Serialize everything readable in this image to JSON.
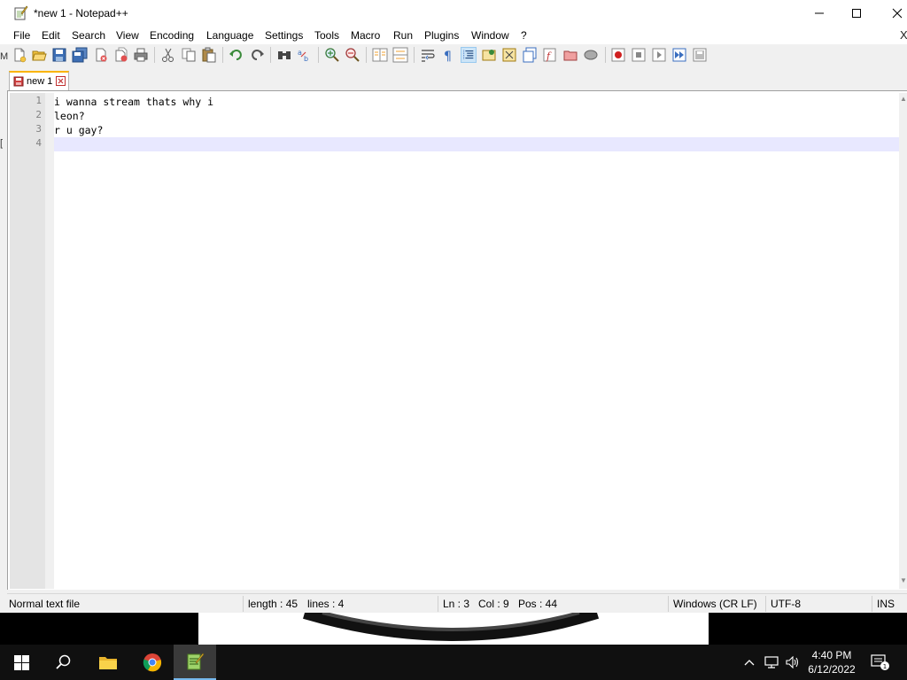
{
  "window": {
    "title": "*new 1 - Notepad++"
  },
  "menu": {
    "items": [
      "File",
      "Edit",
      "Search",
      "View",
      "Encoding",
      "Language",
      "Settings",
      "Tools",
      "Macro",
      "Run",
      "Plugins",
      "Window",
      "?"
    ],
    "close_glyph": "X"
  },
  "toolbar": {
    "icons": [
      "new-file-icon",
      "open-file-icon",
      "save-icon",
      "save-all-icon",
      "close-icon",
      "close-all-icon",
      "print-icon",
      "cut-icon",
      "copy-icon",
      "paste-icon",
      "undo-icon",
      "redo-icon",
      "find-icon",
      "replace-icon",
      "zoom-in-icon",
      "zoom-out-icon",
      "sync-vertical-icon",
      "sync-horizontal-icon",
      "word-wrap-icon",
      "show-all-chars-icon",
      "indent-guide-icon",
      "udl-icon",
      "doc-map-icon",
      "doc-list-icon",
      "function-list-icon",
      "folder-workspace-icon",
      "monitoring-icon",
      "record-macro-icon",
      "stop-record-icon",
      "playback-icon",
      "run-macro-multiple-icon",
      "save-macro-icon"
    ]
  },
  "tabs": [
    {
      "label": "new 1",
      "modified": true
    }
  ],
  "editor": {
    "lines": [
      {
        "num": "1",
        "text": "i wanna stream thats why i"
      },
      {
        "num": "2",
        "text": "leon?"
      },
      {
        "num": "3",
        "text": "r u gay?"
      },
      {
        "num": "4",
        "text": ""
      }
    ],
    "current_line": 4
  },
  "status": {
    "file_type": "Normal text file",
    "length": "length : 45",
    "lines": "lines : 4",
    "ln": "Ln : 3",
    "col": "Col : 9",
    "pos": "Pos : 44",
    "eol": "Windows (CR LF)",
    "encoding": "UTF-8",
    "mode": "INS"
  },
  "taskbar": {
    "apps": [
      "start-button",
      "search-button",
      "file-explorer",
      "chrome",
      "notepad-plus-plus"
    ],
    "active_app": "notepad-plus-plus",
    "clock_time": "4:40 PM",
    "clock_date": "6/12/2022",
    "notification_count": "1"
  },
  "colors": {
    "current_line_bg": "#e8e8ff",
    "gutter_bg": "#e4e4e4",
    "tab_accent": "#fab400",
    "taskbar_bg": "#101010",
    "taskbar_active_indicator": "#76b9ed"
  },
  "left_edge": {
    "mark_top": "M",
    "mark_mid": "["
  }
}
